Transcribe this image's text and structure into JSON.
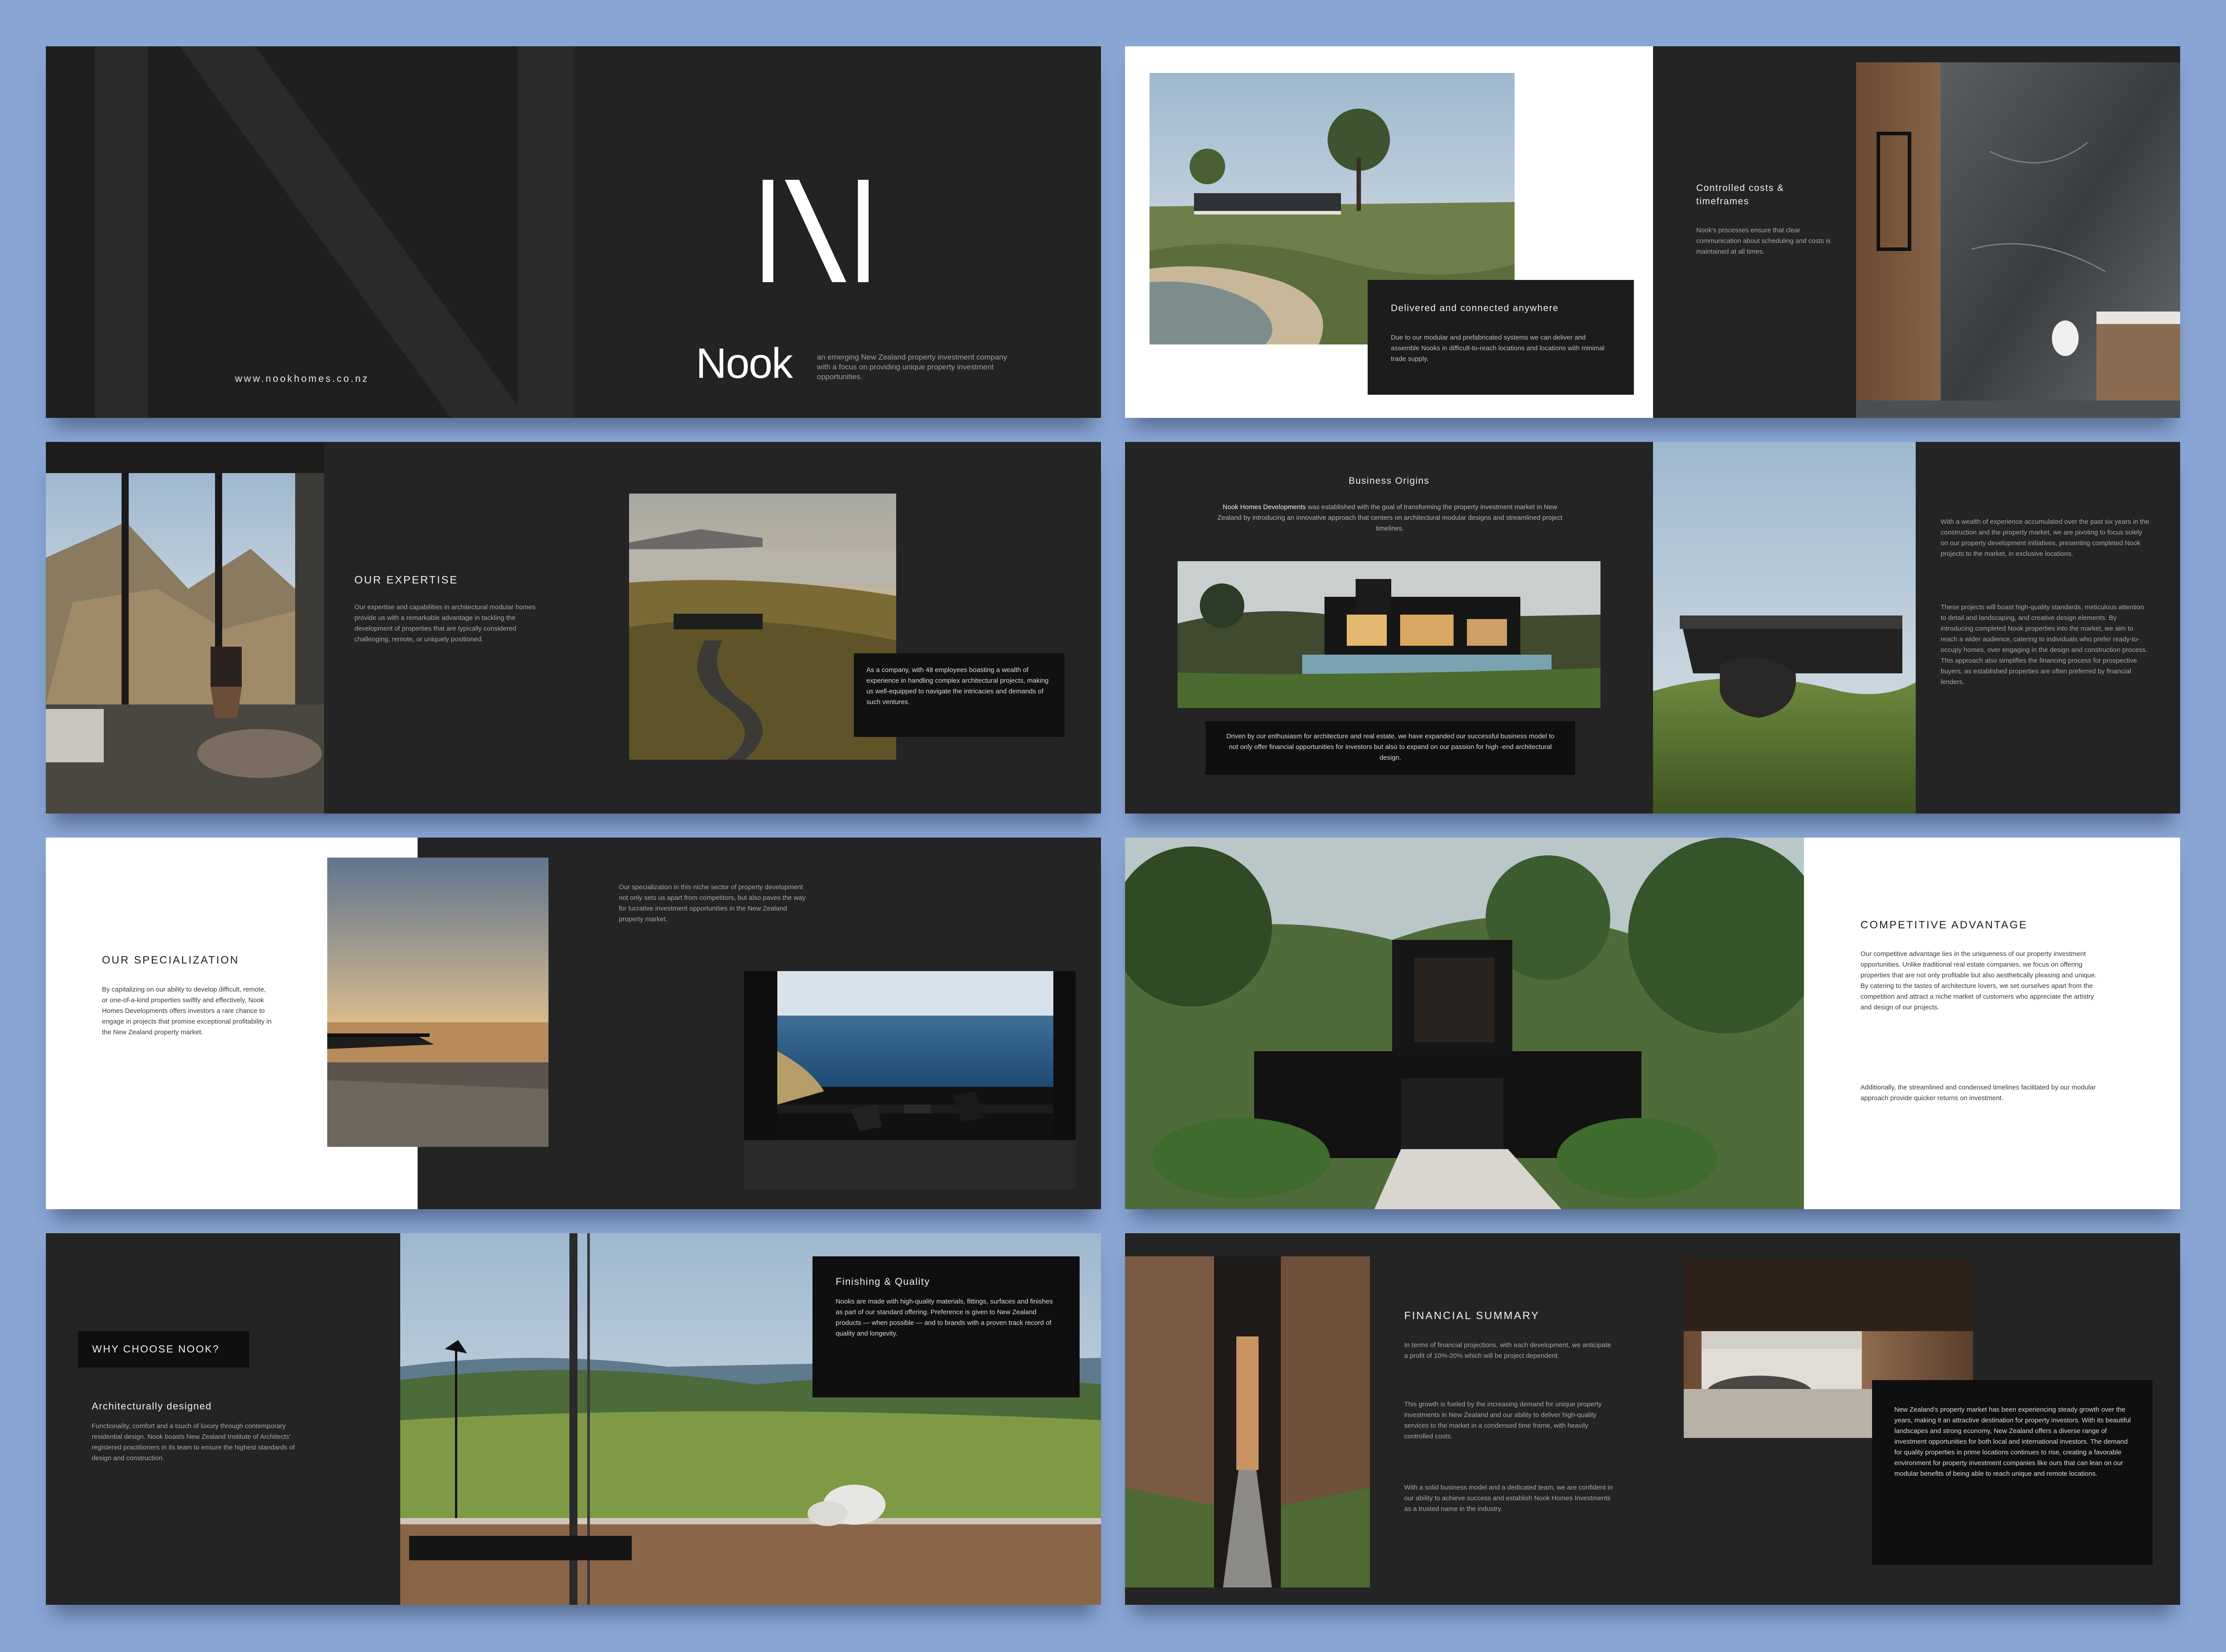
{
  "colors": {
    "background": "#89a5d3",
    "slide_dark": "#242424",
    "slide_light": "#ffffff",
    "box": "#0f0f0f",
    "text_light": "#f2f2f2",
    "text_muted": "#a7a7a7"
  },
  "cover": {
    "website": "www.nookhomes.co.nz",
    "brand": "Nook",
    "tagline": "an emerging New Zealand property investment company with a focus on providing unique property investment opportunities."
  },
  "delivered": {
    "title": "Delivered and connected anywhere",
    "body": "Due to our modular and prefabricated systems we can deliver and assemble Nooks in difficult-to-reach locations and locations with minimal trade supply.",
    "costs_title": "Controlled costs & timeframes",
    "costs_body": "Nook's processes ensure that clear communication about scheduling and costs is maintained at all times."
  },
  "expertise": {
    "title": "OUR EXPERTISE",
    "body": "Our expertise and capabilities in architectural modular homes provide us with a remarkable advantage in tackling the development of properties that are typically considered challenging, remote, or uniquely positioned.",
    "box": "As a company, with 48 employees boasting a wealth of experience in handling complex architectural projects, making us well-equipped to navigate the intricacies and demands of such ventures."
  },
  "origins": {
    "title": "Business Origins",
    "lead_bold": "Nook Homes Developments",
    "lead_rest": "was established with the goal of transforming the property investment market in New Zealand by introducing an innovative approach that centers on architectural modular designs and streamlined project timelines.",
    "box": "Driven by our enthusiasm for architecture and real estate, we have expanded our successful business model to not only offer financial opportunities for investors but also to expand on our passion for high -end architectural design.",
    "side_p1": "With a wealth of experience accumulated over the past six years in the construction and the property market, we are pivoting to focus solely on our property development initiatives, presenting completed Nook projects to the market, in exclusive locations.",
    "side_p2": "These projects will boast high-quality standards, meticulous attention to detail and landscaping, and creative design elements. By introducing completed Nook properties into the market, we aim to reach a wider audience, catering to individuals who prefer ready-to-occupy homes, over engaging in the design and construction process. This approach also simplifies the financing process for prospective buyers, as established properties are often preferred by financial lenders."
  },
  "specialization": {
    "title": "OUR SPECIALIZATION",
    "body": "By capitalizing on our ability to develop difficult, remote, or one-of-a-kind properties swiftly and effectively, Nook Homes Developments offers investors a rare chance to engage in projects that promise exceptional profitability in the New Zealand property market.",
    "right": "Our specialization in this niche sector of property development not only sets us apart from competitors, but also paves the way for lucrative investment opportunities in the New Zealand property market."
  },
  "advantage": {
    "title": "COMPETITIVE ADVANTAGE",
    "p1": "Our competitive advantage lies in the uniqueness of our property investment opportunities. Unlike traditional real estate companies, we focus on offering properties that are not only profitable but also aesthetically pleasing and unique. By catering to the tastes of architecture lovers, we set ourselves apart from the competition and attract a niche market of customers who appreciate the artistry and design of our projects.",
    "p2": "Additionally, the streamlined and condensed timelines facilitated by our modular approach provide quicker returns on investment."
  },
  "why": {
    "badge": "WHY CHOOSE NOOK?",
    "sub": "Architecturally designed",
    "body": "Functionality, comfort and a touch of luxury through contemporary residential design. Nook boasts New Zealand Institute of Architects' registered practitioners in its team to ensure the highest standards of design and construction.",
    "box_title": "Finishing & Quality",
    "box_body": "Nooks are made with high-quality materials, fittings, surfaces and finishes as part of our standard offering. Preference is given to New Zealand products — when possible — and to brands with a proven track record of quality and longevity."
  },
  "financial": {
    "title": "FINANCIAL SUMMARY",
    "p1": "In terms of financial projections, with each development, we anticipate a profit of 10%-20% which will be project dependent.",
    "p2": "This growth is fueled by the increasing demand for unique property investments in New Zealand and our ability to deliver high-quality services to the market in a condensed time frame, with heavily controlled costs.",
    "p3": "With a solid business model and a dedicated team, we are confident in our ability to achieve success and establish Nook Homes Investments as a trusted name in the industry.",
    "box": "New Zealand's property market has been experiencing steady growth over the years, making it an attractive destination for property investors. With its beautiful landscapes and strong economy, New Zealand offers a diverse range of investment opportunities for both local and international investors. The demand for quality properties in prime locations continues to rise, creating a favorable environment for property investment companies like ours that can lean on our modular benefits of being able to reach unique and remote locations."
  }
}
